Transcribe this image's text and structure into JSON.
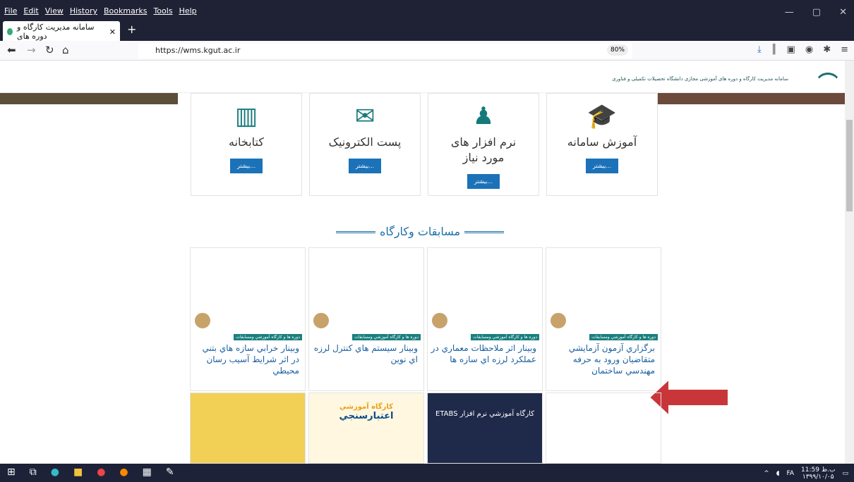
{
  "menubar": {
    "items": [
      "File",
      "Edit",
      "View",
      "History",
      "Bookmarks",
      "Tools",
      "Help"
    ]
  },
  "tab": {
    "title": "سامانه مديريت كارگاه و دوره های"
  },
  "address": {
    "url": "https://wms.kgut.ac.ir",
    "zoom": "80%"
  },
  "site": {
    "name": "سامانه مدیریت کارگاه و دوره های آموزشی مجازی دانشگاه تحصیلات تکمیلی و فناوری"
  },
  "cards": [
    {
      "title": "كتابخانه",
      "button": "بيشتر...",
      "icon": "books-icon"
    },
    {
      "title": "پست الكترونيک",
      "button": "بيشتر...",
      "icon": "mail-icon"
    },
    {
      "title": "نرم افزار های مورد نياز",
      "button": "بيشتر...",
      "icon": "presentation-icon"
    },
    {
      "title": "آموزش سامانه",
      "button": "بيشتر...",
      "icon": "graduation-cap-icon"
    }
  ],
  "section": {
    "title": "مسابقات وكارگاه"
  },
  "posts": [
    {
      "tag": "دوره ها و كارگاه آموزشي ومسابقات",
      "title": "وبينار خرابي سازه هاي بتني در اثر شرايط آسيب رسان محيطي"
    },
    {
      "tag": "دوره ها و كارگاه آموزشي ومسابقات",
      "title": "وبينار سيستم هاي كنترل لرزه اي نوين"
    },
    {
      "tag": "دوره ها و كارگاه آموزشي ومسابقات",
      "title": "وبينار اثر ملاحظات معماري در عملكرد لرزه اي سازه ها"
    },
    {
      "tag": "دوره ها و كارگاه آموزشي ومسابقات",
      "title": "برگزاري آزمون آزمايشي متقاضيان ورود به حرفه مهندسي ساختمان"
    }
  ],
  "posters": {
    "p2": "كارگاه آموزشي",
    "p2sub": "اعتبارسنجي",
    "p3": "كارگاه آموزشي نرم افزار ETABS"
  },
  "taskbar": {
    "time": "11:59 ب.ظ",
    "date": "۱۳۹۹/۱۰/۰۵",
    "lang": "FA"
  }
}
